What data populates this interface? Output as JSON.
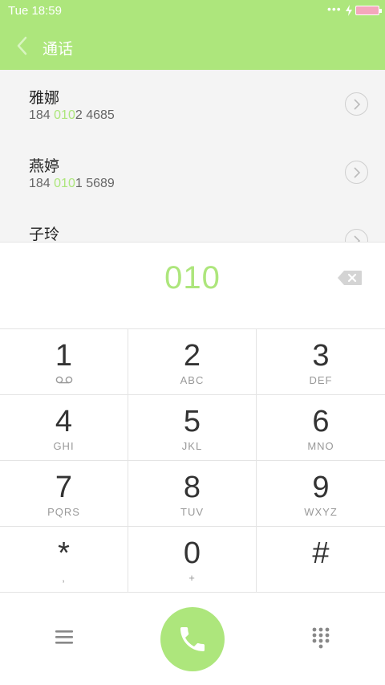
{
  "status_bar": {
    "time": "Tue 18:59",
    "dots": "•••"
  },
  "header": {
    "title": "通话"
  },
  "contacts": [
    {
      "name": "雅娜",
      "num_prefix": "184 ",
      "num_match": "010",
      "num_suffix": "2 4685"
    },
    {
      "name": "燕婷",
      "num_prefix": "184 ",
      "num_match": "010",
      "num_suffix": "1 5689"
    },
    {
      "name": "子玲",
      "num_prefix": "",
      "num_match": "",
      "num_suffix": ""
    }
  ],
  "dialer": {
    "input": "010"
  },
  "keypad": [
    {
      "digit": "1",
      "letters": ""
    },
    {
      "digit": "2",
      "letters": "ABC"
    },
    {
      "digit": "3",
      "letters": "DEF"
    },
    {
      "digit": "4",
      "letters": "GHI"
    },
    {
      "digit": "5",
      "letters": "JKL"
    },
    {
      "digit": "6",
      "letters": "MNO"
    },
    {
      "digit": "7",
      "letters": "PQRS"
    },
    {
      "digit": "8",
      "letters": "TUV"
    },
    {
      "digit": "9",
      "letters": "WXYZ"
    },
    {
      "digit": "*",
      "letters": ","
    },
    {
      "digit": "0",
      "letters": "+"
    },
    {
      "digit": "#",
      "letters": ""
    }
  ],
  "colors": {
    "accent": "#ade67c",
    "list_bg": "#f4f4f4",
    "divider": "#e4e4e4"
  },
  "icons": {
    "back": "chevron-left-icon",
    "delete": "backspace-icon",
    "menu": "menu-icon",
    "call": "phone-icon",
    "keypad": "dialpad-icon",
    "voicemail": "voicemail-icon"
  }
}
